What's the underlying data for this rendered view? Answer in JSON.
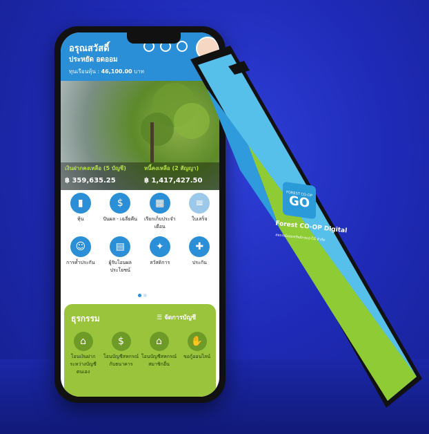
{
  "phone_left": {
    "header": {
      "greeting": "อรุณสวัสดิ์",
      "name": "ประหยัด อดออม",
      "share_label": "ทุนเรือนหุ้น :",
      "share_value": "46,100.00",
      "share_unit": "บาท"
    },
    "balances": [
      {
        "title": "เงินฝากคงเหลือ (5 บัญชี)",
        "value": "฿ 359,635.25"
      },
      {
        "title": "หนี้คงเหลือ (2 สัญญา)",
        "value": "฿ 1,417,427.50"
      }
    ],
    "menu_items": [
      {
        "label": "หุ้น",
        "icon": "chart-icon"
      },
      {
        "label": "ปันผล - เฉลี่ยคืน",
        "icon": "dividend-icon"
      },
      {
        "label": "เรียกเก็บประจำเดือน",
        "icon": "calendar-icon"
      },
      {
        "label": "ใบเสร็จ",
        "icon": "receipt-icon"
      },
      {
        "label": "การค้ำประกัน",
        "icon": "guarantee-icon"
      },
      {
        "label": "ผู้รับโอนผลประโยชน์",
        "icon": "beneficiary-icon"
      },
      {
        "label": "สวัสดิการ",
        "icon": "gift-icon"
      },
      {
        "label": "ประกัน",
        "icon": "shield-icon"
      }
    ],
    "transactions": {
      "title": "ธุรกรรม",
      "manage_label": "จัดการบัญชี",
      "items": [
        {
          "label": "โอนเงินฝากระหว่างบัญชีตนเอง",
          "icon": "bank-icon"
        },
        {
          "label": "โอนบัญชีสหกรณ์กับธนาคาร",
          "icon": "money-cycle-icon"
        },
        {
          "label": "โอนบัญชีสหกรณ์สมาชิกอื่น",
          "icon": "bank-icon"
        },
        {
          "label": "ขอกู้ออนไลน์",
          "icon": "loan-hand-icon"
        }
      ]
    }
  },
  "phone_right": {
    "logo_small": "FOREST CO-OP",
    "logo_text": "GO",
    "app_title": "Forest CO-OP Digital",
    "app_subtitle": "สหกรณ์ออมทรัพย์กรมป่าไม้ จำกัด"
  },
  "colors": {
    "primary": "#2a8fd6",
    "green": "#99c43b",
    "background": "#1f2bb8"
  }
}
